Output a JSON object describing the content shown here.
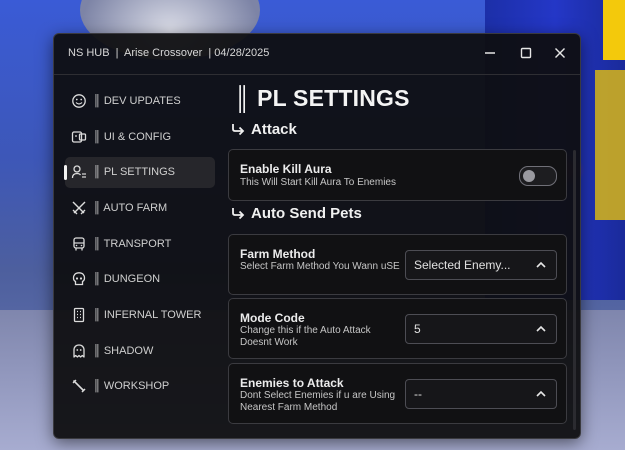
{
  "window": {
    "title": "NS HUB  |  Arise Crossover  | 04/28/2025",
    "controls": [
      "minimize-icon",
      "maximize-icon",
      "close-icon"
    ]
  },
  "sidebar": {
    "items": [
      {
        "label": "║ DEV UPDATES",
        "icon": "smiley-icon",
        "active": false
      },
      {
        "label": "║ UI & CONFIG",
        "icon": "ui-config-icon",
        "active": false
      },
      {
        "label": "║ PL SETTINGS",
        "icon": "user-settings-icon",
        "active": true
      },
      {
        "label": "║ AUTO FARM",
        "icon": "crossed-swords-icon",
        "active": false
      },
      {
        "label": "║ TRANSPORT",
        "icon": "bus-icon",
        "active": false
      },
      {
        "label": "║ DUNGEON",
        "icon": "skull-icon",
        "active": false
      },
      {
        "label": "║ INFERNAL TOWER",
        "icon": "building-icon",
        "active": false
      },
      {
        "label": "║ SHADOW",
        "icon": "ghost-icon",
        "active": false
      },
      {
        "label": "║ WORKSHOP",
        "icon": "wrench-icon",
        "active": false
      }
    ]
  },
  "main": {
    "page_title": "║ PL SETTINGS",
    "sections": {
      "attack": {
        "title": "Attack",
        "kill_aura": {
          "title": "Enable Kill Aura",
          "description": "This Will Start Kill Aura To Enemies",
          "enabled": false
        }
      },
      "auto_send_pets": {
        "title": "Auto Send Pets",
        "farm_method": {
          "title": "Farm Method",
          "description": "Select Farm Method You Wann uSE",
          "value": "Selected Enemy..."
        },
        "mode_code": {
          "title": "Mode Code",
          "description": "Change this if the Auto Attack Doesnt Work",
          "value": "5"
        },
        "enemies_to_attack": {
          "title": "Enemies to Attack",
          "description": "Dont Select Enemies if u are Using Nearest Farm Method",
          "value": "--"
        }
      }
    }
  },
  "colors": {
    "window_bg": "#0e0e10",
    "card_border": "#3b3b40",
    "active_nav_bg": "#26262b",
    "text": "#e8e8e8"
  }
}
